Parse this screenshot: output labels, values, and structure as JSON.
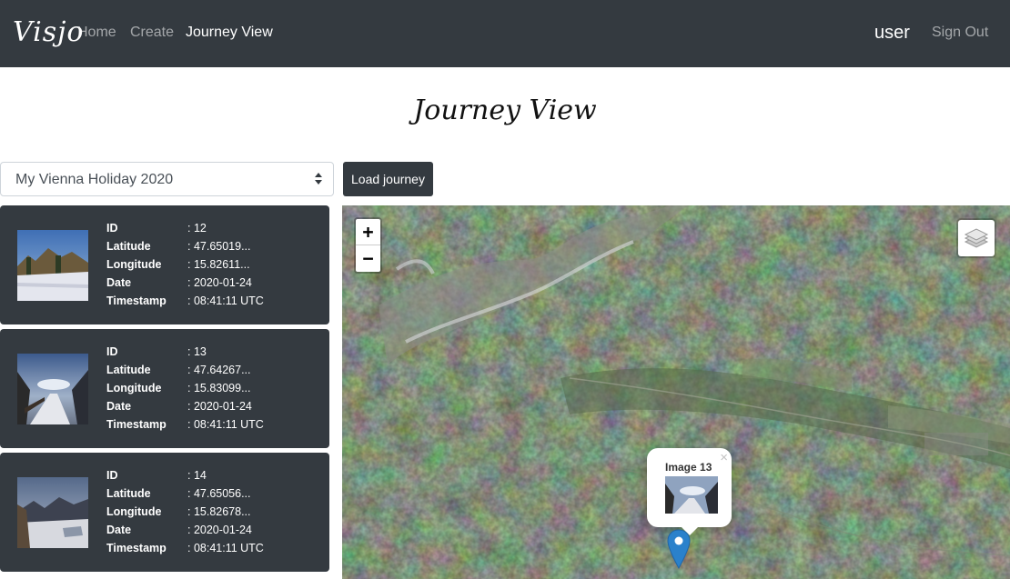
{
  "navbar": {
    "brand": "Visjo",
    "links": [
      {
        "label": "Home",
        "active": false
      },
      {
        "label": "Create",
        "active": false
      },
      {
        "label": "Journey View",
        "active": true
      }
    ],
    "user": "user",
    "sign_out": "Sign Out"
  },
  "page": {
    "title": "Journey View"
  },
  "controls": {
    "journey_select_value": "My Vienna Holiday 2020",
    "load_button": "Load journey"
  },
  "field_labels": {
    "id": "ID",
    "latitude": "Latitude",
    "longitude": "Longitude",
    "date": "Date",
    "timestamp": "Timestamp"
  },
  "images": [
    {
      "id": ": 12",
      "latitude": ": 47.65019...",
      "longitude": ": 15.82611...",
      "date": ": 2020-01-24",
      "timestamp": ": 08:41:11 UTC"
    },
    {
      "id": ": 13",
      "latitude": ": 47.64267...",
      "longitude": ": 15.83099...",
      "date": ": 2020-01-24",
      "timestamp": ": 08:41:11 UTC"
    },
    {
      "id": ": 14",
      "latitude": ": 47.65056...",
      "longitude": ": 15.82678...",
      "date": ": 2020-01-24",
      "timestamp": ": 08:41:11 UTC"
    }
  ],
  "map": {
    "zoom_in": "+",
    "zoom_out": "−",
    "popup_title": "Image 13",
    "popup_close": "×",
    "marker_color": "#2a81cb"
  }
}
